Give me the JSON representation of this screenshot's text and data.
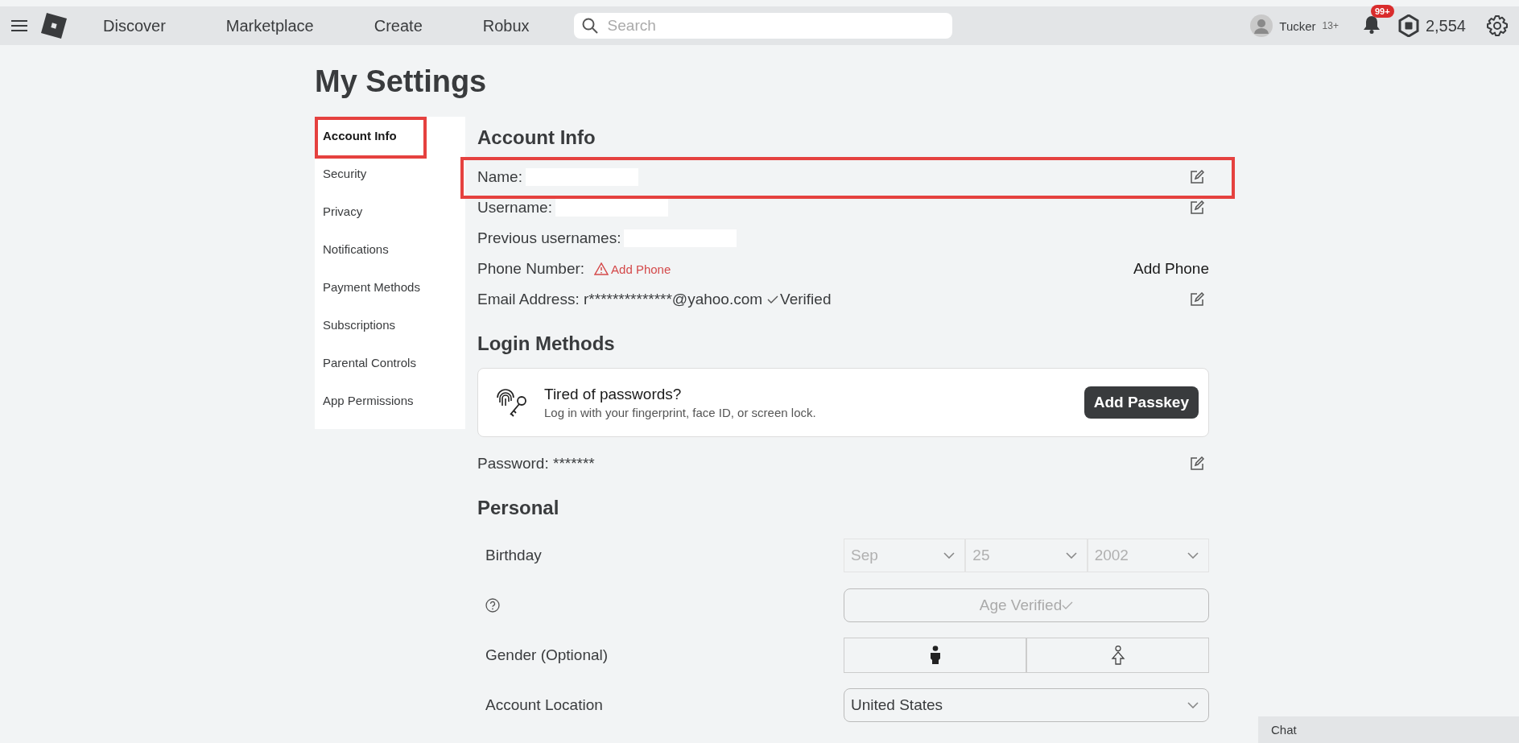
{
  "top_bar": {
    "nav": [
      "Discover",
      "Marketplace",
      "Create",
      "Robux"
    ],
    "search": {
      "placeholder": "Search"
    },
    "user": {
      "name": "Tucker",
      "age_badge": "13+"
    },
    "notifications": {
      "badge": "99+"
    },
    "robux": "2,554"
  },
  "page_title": "My Settings",
  "sidebar": {
    "items": [
      {
        "label": "Account Info",
        "selected": true,
        "highlighted": true
      },
      {
        "label": "Security",
        "selected": false,
        "highlighted": false
      },
      {
        "label": "Privacy",
        "selected": false,
        "highlighted": false
      },
      {
        "label": "Notifications",
        "selected": false,
        "highlighted": false
      },
      {
        "label": "Payment Methods",
        "selected": false,
        "highlighted": false
      },
      {
        "label": "Subscriptions",
        "selected": false,
        "highlighted": false
      },
      {
        "label": "Parental Controls",
        "selected": false,
        "highlighted": false
      },
      {
        "label": "App Permissions",
        "selected": false,
        "highlighted": false
      }
    ]
  },
  "account_info": {
    "title": "Account Info",
    "fields": [
      {
        "kind": "text",
        "label": "Name:",
        "redacted": true,
        "editable": true,
        "highlighted": true
      },
      {
        "kind": "text",
        "label": "Username:",
        "redacted": true,
        "editable": true,
        "highlighted": false
      },
      {
        "kind": "text",
        "label": "Previous usernames:",
        "redacted": true,
        "editable": false,
        "highlighted": false
      },
      {
        "kind": "phone",
        "label": "Phone Number:",
        "warning": "Add Phone",
        "action": "Add Phone",
        "editable": false,
        "highlighted": false
      },
      {
        "kind": "email",
        "label": "Email Address:",
        "value": "r**************@yahoo.com",
        "status": "Verified",
        "editable": true,
        "highlighted": false
      }
    ]
  },
  "login_methods": {
    "title": "Login Methods",
    "passkey_card": {
      "title": "Tired of passwords?",
      "subtitle": "Log in with your fingerprint, face ID, or screen lock.",
      "button": "Add Passkey"
    },
    "password": {
      "label": "Password:",
      "value": "*******",
      "editable": true
    }
  },
  "personal": {
    "title": "Personal",
    "rows": [
      {
        "kind": "date",
        "label": "Birthday",
        "selects": [
          "Sep",
          "25",
          "2002"
        ]
      },
      {
        "kind": "status",
        "value": "Age Verified"
      },
      {
        "kind": "gender",
        "label": "Gender (Optional)"
      },
      {
        "kind": "select",
        "label": "Account Location",
        "value": "United States"
      }
    ]
  },
  "chat": {
    "label": "Chat"
  }
}
